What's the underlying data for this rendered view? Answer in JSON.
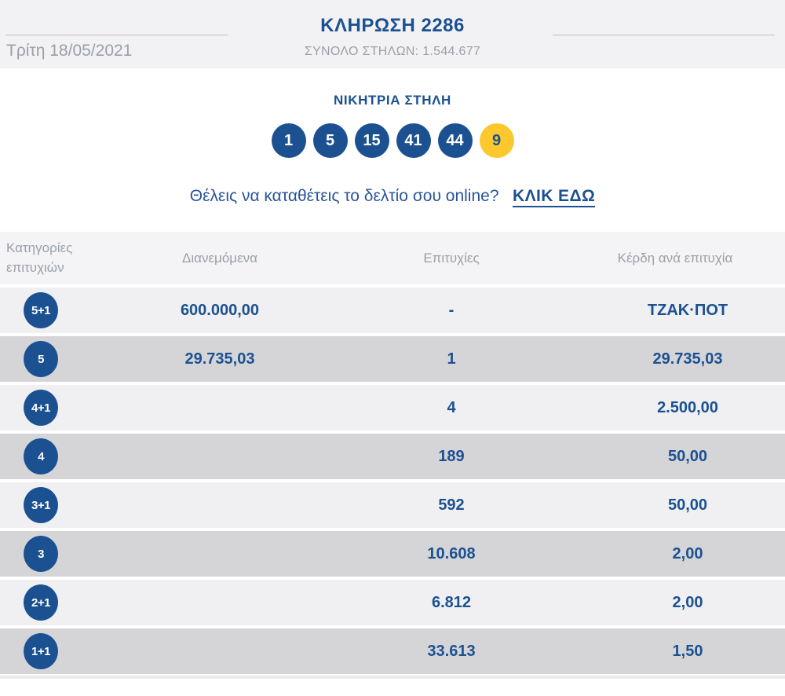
{
  "header": {
    "title": "ΚΛΗΡΩΣΗ 2286",
    "subtitle": "ΣΥΝΟΛΟ ΣΤΗΛΩΝ: 1.544.677",
    "date": "Τρίτη 18/05/2021"
  },
  "winning": {
    "heading": "ΝΙΚΗΤΡΙΑ ΣΤΗΛΗ",
    "numbers": [
      "1",
      "5",
      "15",
      "41",
      "44"
    ],
    "joker_number": "9"
  },
  "cta": {
    "question": "Θέλεις να καταθέτεις το δελτίο σου online?",
    "link_label": "ΚΛΙΚ ΕΔΩ"
  },
  "table": {
    "headers": {
      "category": "Κατηγορίες επιτυχιών",
      "distributed": "Διανεμόμενα",
      "winners": "Επιτυχίες",
      "prize": "Κέρδη ανά επιτυχία"
    },
    "rows": [
      {
        "category": "5+1",
        "distributed": "600.000,00",
        "winners": "-",
        "prize": "ΤΖΑΚ·ΠΟΤ"
      },
      {
        "category": "5",
        "distributed": "29.735,03",
        "winners": "1",
        "prize": "29.735,03"
      },
      {
        "category": "4+1",
        "distributed": "",
        "winners": "4",
        "prize": "2.500,00"
      },
      {
        "category": "4",
        "distributed": "",
        "winners": "189",
        "prize": "50,00"
      },
      {
        "category": "3+1",
        "distributed": "",
        "winners": "592",
        "prize": "50,00"
      },
      {
        "category": "3",
        "distributed": "",
        "winners": "10.608",
        "prize": "2,00"
      },
      {
        "category": "2+1",
        "distributed": "",
        "winners": "6.812",
        "prize": "2,00"
      },
      {
        "category": "1+1",
        "distributed": "",
        "winners": "33.613",
        "prize": "1,50"
      }
    ]
  },
  "colors": {
    "brand_blue": "#1b5191",
    "joker_yellow": "#fdc72e",
    "muted_gray_text": "#9aa0a8",
    "row_light": "#f0f0f2",
    "row_dark": "#d5d5d8",
    "band_gray": "#f2f2f4"
  }
}
